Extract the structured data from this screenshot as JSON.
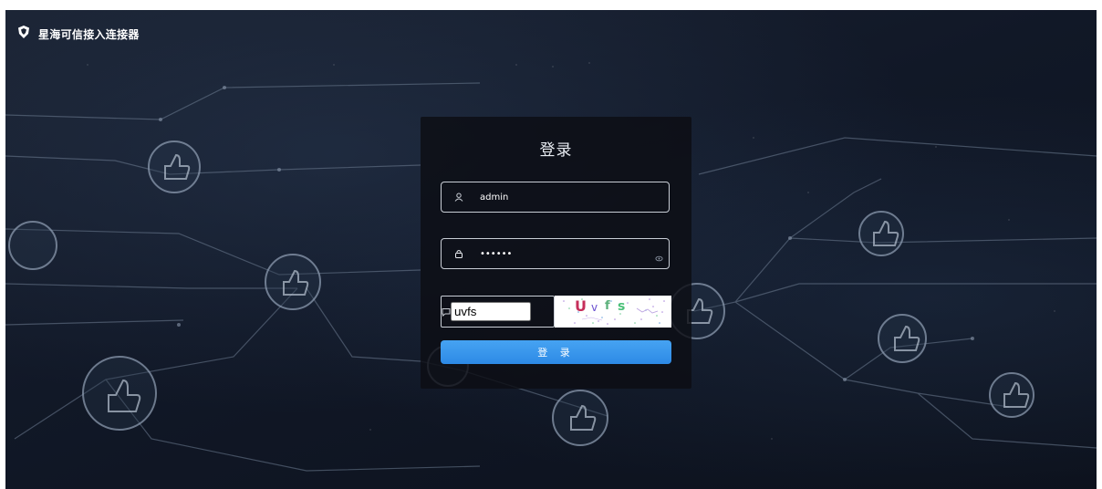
{
  "brand": {
    "title": "星海可信接入连接器",
    "logo_icon": "shield-icon"
  },
  "login": {
    "title": "登录",
    "username": {
      "value": "admin",
      "icon": "user-icon"
    },
    "password": {
      "value": "••••••",
      "icon": "lock-icon",
      "toggle_icon": "eye-icon"
    },
    "captcha": {
      "value": "uvfs",
      "icon": "message-icon",
      "image_text": "Uvfs"
    },
    "submit_label": "登 录"
  },
  "colors": {
    "background": "#111827",
    "panel": "#0c0e14",
    "button": "#3a96ee",
    "field_border": "#c9ced6"
  }
}
